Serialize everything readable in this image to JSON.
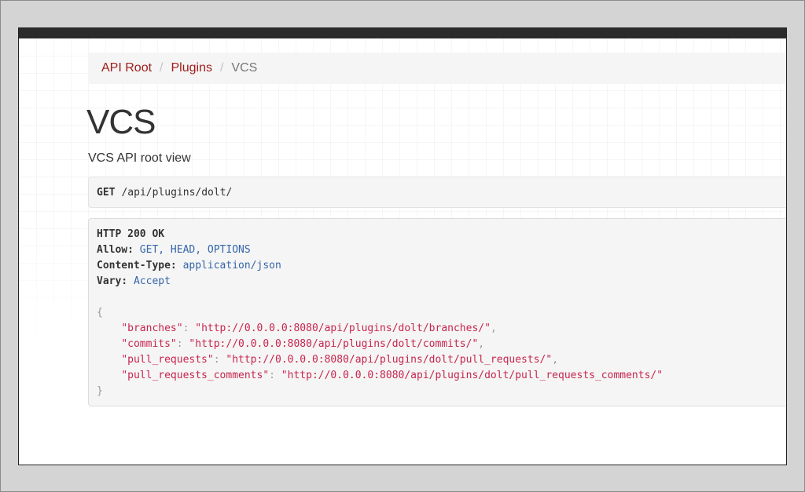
{
  "breadcrumb": {
    "items": [
      "API Root",
      "Plugins"
    ],
    "separator": "/",
    "active": "VCS"
  },
  "page": {
    "title": "VCS",
    "description": "VCS API root view"
  },
  "request": {
    "method": "GET",
    "path": "/api/plugins/dolt/"
  },
  "response": {
    "status": "HTTP 200 OK",
    "headers": [
      {
        "key": "Allow:",
        "value": "GET, HEAD, OPTIONS"
      },
      {
        "key": "Content-Type:",
        "value": "application/json"
      },
      {
        "key": "Vary:",
        "value": "Accept"
      }
    ],
    "open_brace": "{",
    "close_brace": "}",
    "body": [
      {
        "key": "\"branches\"",
        "value": "\"http://0.0.0.0:8080/api/plugins/dolt/branches/\"",
        "trail": ","
      },
      {
        "key": "\"commits\"",
        "value": "\"http://0.0.0.0:8080/api/plugins/dolt/commits/\"",
        "trail": ","
      },
      {
        "key": "\"pull_requests\"",
        "value": "\"http://0.0.0.0:8080/api/plugins/dolt/pull_requests/\"",
        "trail": ","
      },
      {
        "key": "\"pull_requests_comments\"",
        "value": "\"http://0.0.0.0:8080/api/plugins/dolt/pull_requests_comments/\"",
        "trail": ""
      }
    ]
  },
  "colors": {
    "link": "#a11c1c",
    "header_value": "#3566a8",
    "json_string": "#c7254e"
  }
}
